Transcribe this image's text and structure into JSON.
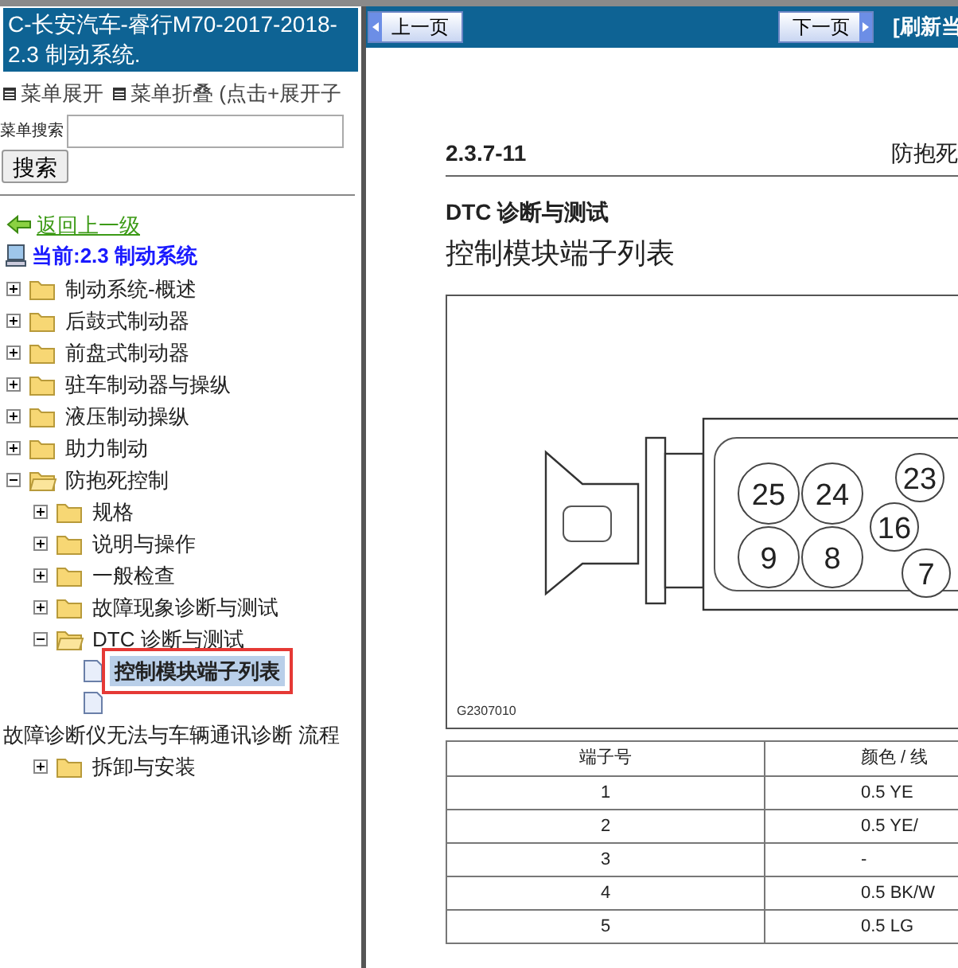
{
  "sidebar": {
    "title": "C-长安汽车-睿行M70-2017-2018- 2.3 制动系统.",
    "menu_links": [
      "菜单展开",
      "菜单折叠 (点击+展开子"
    ],
    "search": {
      "label": "菜单搜索",
      "button": "搜索"
    },
    "back_link": "返回上一级",
    "current": "当前:2.3 制动系统",
    "tree": [
      {
        "kind": "folder",
        "label": "制动系统-概述",
        "expanded": false
      },
      {
        "kind": "folder",
        "label": "后鼓式制动器",
        "expanded": false
      },
      {
        "kind": "folder",
        "label": "前盘式制动器",
        "expanded": false
      },
      {
        "kind": "folder",
        "label": "驻车制动器与操纵",
        "expanded": false
      },
      {
        "kind": "folder",
        "label": "液压制动操纵",
        "expanded": false
      },
      {
        "kind": "folder",
        "label": "助力制动",
        "expanded": false
      },
      {
        "kind": "folder",
        "label": "防抱死控制",
        "expanded": true,
        "children": [
          {
            "kind": "folder",
            "label": "规格",
            "expanded": false
          },
          {
            "kind": "folder",
            "label": "说明与操作",
            "expanded": false
          },
          {
            "kind": "folder",
            "label": "一般检查",
            "expanded": false
          },
          {
            "kind": "folder",
            "label": "故障现象诊断与测试",
            "expanded": false
          },
          {
            "kind": "folder",
            "label": "DTC 诊断与测试",
            "expanded": true,
            "children": [
              {
                "kind": "page",
                "label": "控制模块端子列表",
                "selected": true
              },
              {
                "kind": "page",
                "selected": false
              }
            ]
          },
          {
            "kind": "note",
            "label": "故障诊断仪无法与车辆通讯诊断 流程"
          },
          {
            "kind": "folder",
            "label": "拆卸与安装",
            "expanded": false
          }
        ]
      }
    ]
  },
  "toolbar": {
    "prev": "上一页",
    "next": "下一页",
    "refresh": "[刷新当"
  },
  "document": {
    "page_number": "2.3.7-11",
    "section": "防抱死",
    "heading": "DTC 诊断与测试",
    "title": "控制模块端子列表",
    "figure": {
      "pins": [
        "25",
        "24",
        "9",
        "8",
        "23",
        "16",
        "7"
      ],
      "code": "G2307010"
    },
    "table": {
      "columns": [
        "端子号",
        "颜色 / 线"
      ],
      "rows": [
        [
          "1",
          "0.5 YE"
        ],
        [
          "2",
          "0.5 YE/"
        ],
        [
          "3",
          "-"
        ],
        [
          "4",
          "0.5 BK/W"
        ],
        [
          "5",
          "0.5 LG"
        ]
      ]
    }
  }
}
